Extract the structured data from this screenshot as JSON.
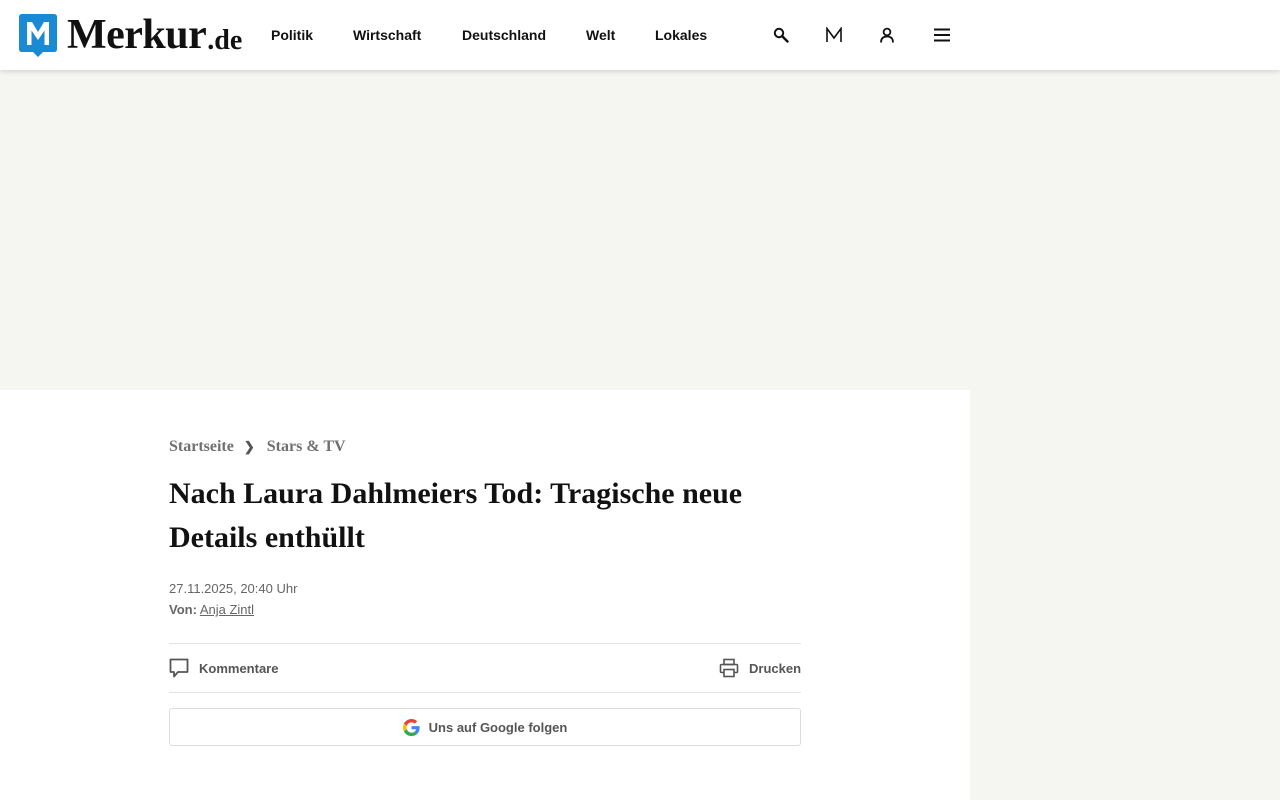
{
  "site": {
    "logo_text": "Merkur",
    "logo_tld": ".de",
    "brand_color": "#1a8ad4"
  },
  "nav": {
    "items": [
      "Politik",
      "Wirtschaft",
      "Deutschland",
      "Welt",
      "Lokales"
    ]
  },
  "header_icons": [
    "search-icon",
    "merkur-m-icon",
    "user-account-icon",
    "menu-hamburger-icon"
  ],
  "breadcrumb": {
    "home": "Startseite",
    "separator": "❯",
    "section": "Stars & TV"
  },
  "article": {
    "headline": "Nach Laura Dahlmeiers Tod: Tragische neue Details enthüllt",
    "date": "27.11.2025, 20:40 Uhr",
    "author_label": "Von:",
    "author_name": "Anja Zintl"
  },
  "actions": {
    "comments_label": "Kommentare",
    "print_label": "Drucken",
    "google_follow_label": "Uns auf Google folgen"
  }
}
